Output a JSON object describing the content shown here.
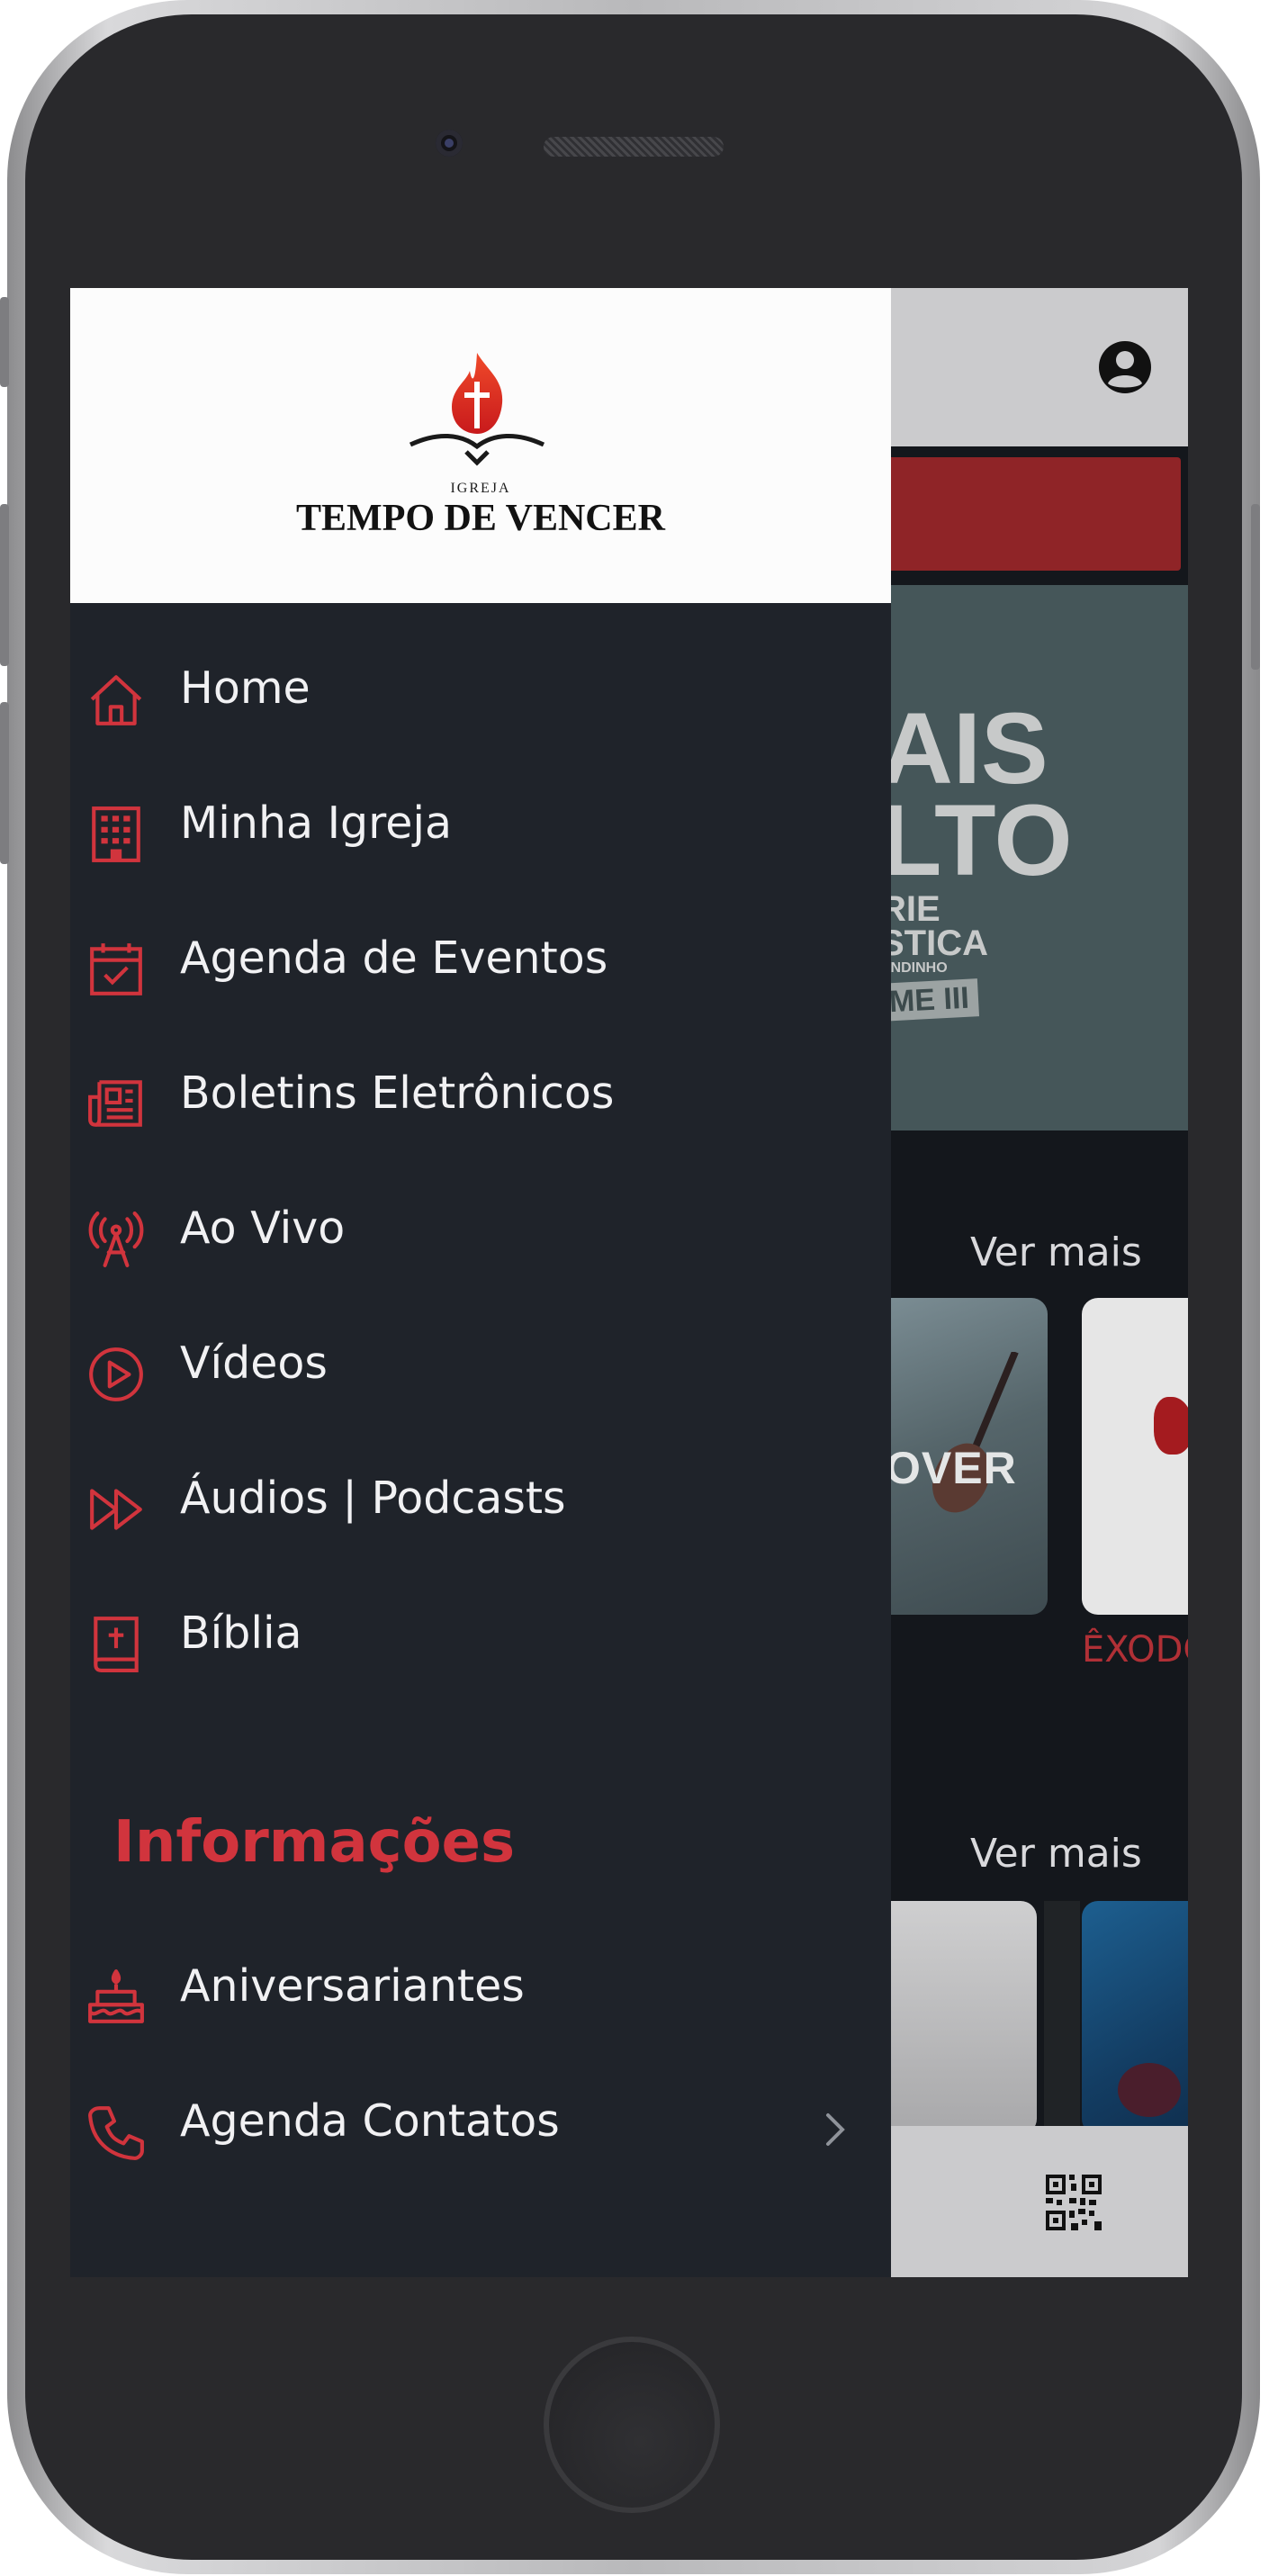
{
  "app": {
    "logo_alt_small": "IGREJA",
    "logo_name": "TEMPO DE VENCER"
  },
  "drawer": {
    "menu": [
      {
        "label": "Home",
        "icon": "home-icon"
      },
      {
        "label": "Minha Igreja",
        "icon": "building-icon"
      },
      {
        "label": "Agenda de Eventos",
        "icon": "calendar-check-icon"
      },
      {
        "label": "Boletins Eletrônicos",
        "icon": "newspaper-icon"
      },
      {
        "label": "Ao Vivo",
        "icon": "broadcast-tower-icon"
      },
      {
        "label": "Vídeos",
        "icon": "play-circle-icon"
      },
      {
        "label": "Áudios | Podcasts",
        "icon": "fast-forward-icon"
      },
      {
        "label": "Bíblia",
        "icon": "bible-icon"
      }
    ],
    "section_title": "Informações",
    "info_items": [
      {
        "label": "Aniversariantes",
        "icon": "birthday-cake-icon"
      },
      {
        "label": "Agenda Contatos",
        "icon": "phone-icon",
        "has_chevron": true
      }
    ]
  },
  "background": {
    "banner_lines": [
      "AIS",
      "LTO",
      "RIE",
      "STICA",
      "ANDINHO",
      "ME III"
    ],
    "see_more_1": "Ver mais",
    "see_more_2": "Ver mais",
    "thumb_text": "OVER",
    "exodo_label": "ÊXODO"
  },
  "colors": {
    "accent": "#d1343d",
    "drawer_bg": "#1f232a",
    "header_bg": "#fcfcfc",
    "app_bar": "#cbcbcd"
  }
}
